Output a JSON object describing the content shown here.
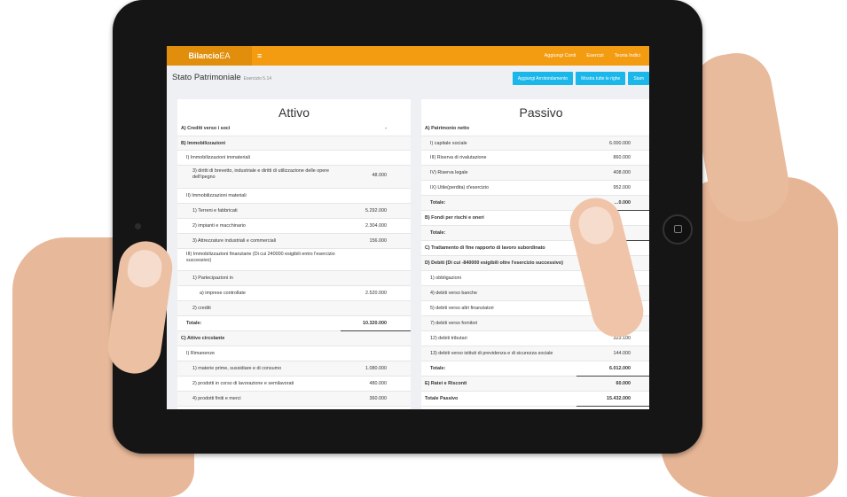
{
  "topbar": {
    "brand_main": "Bilancio",
    "brand_suffix": "EA",
    "menu_icon": "hamburger-icon",
    "nav": [
      "Aggiungi Conti",
      "Esercizi",
      "Teoria Indici"
    ]
  },
  "header": {
    "title": "Stato Patrimoniale",
    "subtitle": "Esercizio 5.14",
    "buttons": [
      "Aggiungi Arrotondamento",
      "Mostra tutte le righe",
      "Stam"
    ]
  },
  "attivo": {
    "title": "Attivo",
    "rows": [
      {
        "label": "A) Crediti verso i soci",
        "value": "-",
        "bold": true
      },
      {
        "label": "B) Immobilizzazioni",
        "value": "",
        "bold": true
      },
      {
        "label": "I) Immobilizzazioni immateriali",
        "value": ""
      },
      {
        "label": "3) diritti di brevetto, industriale e diritti di utilizzazione delle opere dell'ipegno",
        "value": "48.000"
      },
      {
        "label": "II) Immobilizzazioni materiali",
        "value": ""
      },
      {
        "label": "1) Terreni e fabbricati",
        "value": "5.292.000"
      },
      {
        "label": "2) impianti e macchinario",
        "value": "2.304.000"
      },
      {
        "label": "3) Attrezzature industriali e commerciali",
        "value": "156.000"
      },
      {
        "label": "III) Immobilizzazioni finanziarie (Di cui 240000 esigibili entro l'esercizio successivo)",
        "value": ""
      },
      {
        "label": "1) Partecipazioni in",
        "value": ""
      },
      {
        "label": "a) imprese controllate",
        "value": "2.520.000"
      },
      {
        "label": "2) crediti",
        "value": ""
      },
      {
        "label": "Totale:",
        "value": "10.320.000",
        "bold": true
      },
      {
        "label": "C) Attivo circolante",
        "value": "",
        "bold": true
      },
      {
        "label": "I) Rimanenze",
        "value": ""
      },
      {
        "label": "1) materie prime, sussidiare e di consumo",
        "value": "1.080.000"
      },
      {
        "label": "2) prodotti in corso di lavorazione e semilavorati",
        "value": "480.000"
      },
      {
        "label": "4) prodotti finiti e merci",
        "value": "360.000"
      }
    ]
  },
  "passivo": {
    "title": "Passivo",
    "rows": [
      {
        "label": "A) Patrimonio netto",
        "value": "",
        "bold": true
      },
      {
        "label": "I) capitale sociale",
        "value": "6.000.000"
      },
      {
        "label": "III) Riserva di rivalutazione",
        "value": "860.000"
      },
      {
        "label": "IV) Riserva legale",
        "value": "408.000"
      },
      {
        "label": "IX) Utile(perdita) d'esercizio",
        "value": "952.000"
      },
      {
        "label": "Totale:",
        "value": "…0.000",
        "bold": true
      },
      {
        "label": "B) Fondi per rischi e oneri",
        "value": "",
        "bold": true
      },
      {
        "label": "Totale:",
        "value": "",
        "bold": true
      },
      {
        "label": "C) Trattamento di fine rapporto di lavoro subordinato",
        "value": "",
        "bold": true
      },
      {
        "label": "D) Debiti (Di cui -840000 esigibili oltre l'esercizio successivo)",
        "value": "",
        "bold": true
      },
      {
        "label": "1) obbligazioni",
        "value": "2.640…"
      },
      {
        "label": "4) debiti verso banche",
        "value": "1.248.000"
      },
      {
        "label": "5) debiti verso altri finanziatori",
        "value": "336.900"
      },
      {
        "label": "7) debiti verso fornitori",
        "value": "1.320.000"
      },
      {
        "label": "12) debiti tributari",
        "value": "323.100"
      },
      {
        "label": "13) debiti verso istituti di previdenza e di sicurezza sociale",
        "value": "144.000"
      },
      {
        "label": "Totale:",
        "value": "6.012.000",
        "bold": true
      },
      {
        "label": "E) Ratei e Risconti",
        "value": "60.000",
        "bold": true
      },
      {
        "label": "Totale Passivo",
        "value": "15.432.000",
        "bold": true
      }
    ]
  }
}
